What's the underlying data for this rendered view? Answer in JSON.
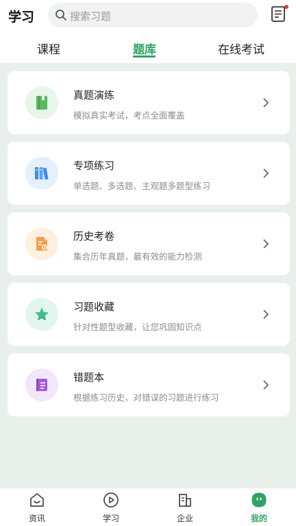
{
  "header": {
    "title": "学习",
    "search_placeholder": "搜索习题",
    "notification_dot_color": "#e53935"
  },
  "tabs": [
    {
      "label": "课程",
      "active": false
    },
    {
      "label": "题库",
      "active": true
    },
    {
      "label": "在线考试",
      "active": false
    }
  ],
  "cards": [
    {
      "title": "真题演练",
      "desc": "模拟真实考试，考点全面覆盖",
      "icon": "book-icon",
      "icon_color": "#5cb85c",
      "icon_bg": "#e6f6ea"
    },
    {
      "title": "专项练习",
      "desc": "单选题、多选题、主观题多题型练习",
      "icon": "books-icon",
      "icon_color": "#3e8ef0",
      "icon_bg": "#e5f0fc"
    },
    {
      "title": "历史考卷",
      "desc": "集合历年真题，最有效的能力检测",
      "icon": "exam-paper-icon",
      "icon_color": "#f0a04b",
      "icon_bg": "#fdf0df"
    },
    {
      "title": "习题收藏",
      "desc": "针对性题型收藏，让您巩固知识点",
      "icon": "star-icon",
      "icon_color": "#3cbf8c",
      "icon_bg": "#e2f6ee"
    },
    {
      "title": "错题本",
      "desc": "根据练习历史，对错误的习题进行练习",
      "icon": "notebook-icon",
      "icon_color": "#a45cd6",
      "icon_bg": "#f2e6fa"
    }
  ],
  "bottom_nav": [
    {
      "label": "资讯",
      "icon": "home-icon",
      "active": false
    },
    {
      "label": "学习",
      "icon": "play-icon",
      "active": false
    },
    {
      "label": "企业",
      "icon": "building-icon",
      "active": false
    },
    {
      "label": "我的",
      "icon": "profile-face-icon",
      "active": true
    }
  ],
  "colors": {
    "accent": "#2ea363",
    "content_bg": "#e9f0ec"
  }
}
